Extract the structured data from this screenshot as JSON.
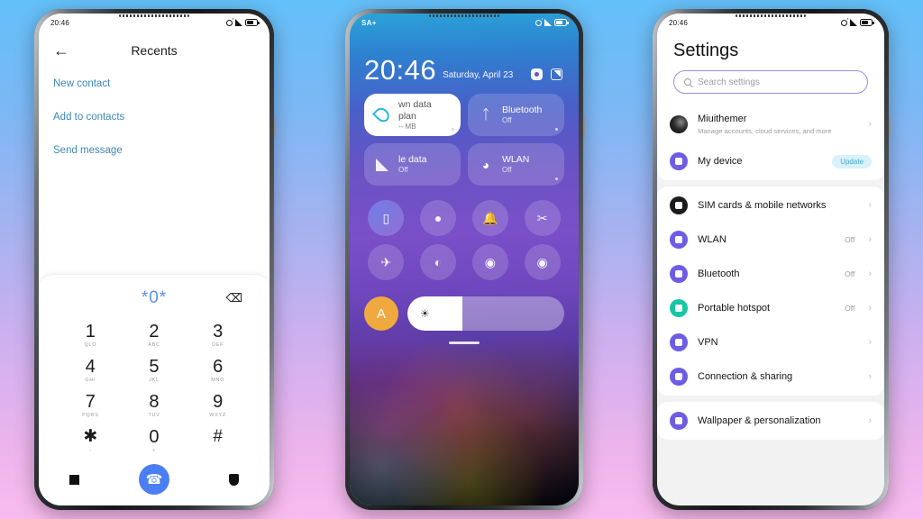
{
  "background": {
    "top_color": "#63c0f8",
    "bottom_color": "#f9bbee"
  },
  "phone1": {
    "status": {
      "time": "20:46"
    },
    "appbar": {
      "back_icon": "arrow-left-icon",
      "title": "Recents"
    },
    "links": [
      "New contact",
      "Add to contacts",
      "Send message"
    ],
    "dialer": {
      "number": "*0*",
      "delete_icon": "backspace-icon",
      "keys": [
        {
          "digit": "1",
          "letters": "QLD"
        },
        {
          "digit": "2",
          "letters": "ABC"
        },
        {
          "digit": "3",
          "letters": "DEF"
        },
        {
          "digit": "4",
          "letters": "GHI"
        },
        {
          "digit": "5",
          "letters": "JKL"
        },
        {
          "digit": "6",
          "letters": "MNO"
        },
        {
          "digit": "7",
          "letters": "PQRS"
        },
        {
          "digit": "8",
          "letters": "TUV"
        },
        {
          "digit": "9",
          "letters": "WXYZ"
        },
        {
          "digit": "✱",
          "letters": ","
        },
        {
          "digit": "0",
          "letters": "+"
        },
        {
          "digit": "#",
          "letters": ""
        }
      ],
      "left_icon": "keypad-hide-icon",
      "call_icon": "phone-call-icon",
      "right_icon": "shield-icon",
      "accent_color": "#4c7ef3",
      "number_color": "#5b8ff0"
    }
  },
  "phone2": {
    "status": {
      "carrier": "SA+"
    },
    "clock": {
      "time": "20:46",
      "date": "Saturday, April 23"
    },
    "header_icons": [
      "settings-gear-icon",
      "edit-tiles-icon"
    ],
    "tiles": [
      {
        "title": "wn data plan",
        "subtitle": "-- MB",
        "icon": "water-drop-icon",
        "style": "white"
      },
      {
        "title": "Bluetooth",
        "subtitle": "Off",
        "icon": "bluetooth-icon",
        "style": "translucent"
      },
      {
        "title": "le data",
        "subtitle": "Off",
        "icon": "mobile-signal-icon",
        "style": "translucent"
      },
      {
        "title": "WLAN",
        "subtitle": "Off",
        "icon": "wifi-icon",
        "style": "translucent"
      }
    ],
    "toggles": [
      {
        "name": "vibrate-icon",
        "glyph": "▯",
        "active": true
      },
      {
        "name": "flashlight-icon",
        "glyph": "●",
        "active": false
      },
      {
        "name": "ringer-bell-icon",
        "glyph": "🔔",
        "active": false
      },
      {
        "name": "screenshot-scissors-icon",
        "glyph": "✂",
        "active": false
      },
      {
        "name": "airplane-mode-icon",
        "glyph": "✈",
        "active": false
      },
      {
        "name": "dark-mode-icon",
        "glyph": "◐",
        "active": false
      },
      {
        "name": "location-icon",
        "glyph": "◉",
        "active": false
      },
      {
        "name": "screen-record-icon",
        "glyph": "◉",
        "active": false
      }
    ],
    "brightness": {
      "auto_label": "A",
      "auto_color": "#f0a93f",
      "level_percent": 35,
      "icon": "brightness-sun-icon"
    },
    "home_indicator": "home-bar"
  },
  "phone3": {
    "status": {
      "time": "20:46"
    },
    "title": "Settings",
    "search": {
      "placeholder": "Search settings",
      "icon": "search-icon",
      "border_color": "#9f8de6"
    },
    "account": {
      "name": "Miuithemer",
      "subtitle": "Manage accounts, cloud services, and more",
      "icon": "account-avatar"
    },
    "device": {
      "label": "My device",
      "badge": "Update",
      "icon_color": "#6c5ce7",
      "badge_bg": "#d8f1fb",
      "badge_color": "#4ba7c9"
    },
    "network_group": [
      {
        "label": "SIM cards & mobile networks",
        "value": "",
        "icon_color": "#1b1b1b"
      },
      {
        "label": "WLAN",
        "value": "Off",
        "icon_color": "#6c5ce7"
      },
      {
        "label": "Bluetooth",
        "value": "Off",
        "icon_color": "#6c5ce7"
      },
      {
        "label": "Portable hotspot",
        "value": "Off",
        "icon_color": "#17c6a3"
      },
      {
        "label": "VPN",
        "value": "",
        "icon_color": "#6c5ce7"
      },
      {
        "label": "Connection & sharing",
        "value": "",
        "icon_color": "#6c5ce7"
      }
    ],
    "personal_group": [
      {
        "label": "Wallpaper & personalization",
        "value": "",
        "icon_color": "#6c5ce7"
      }
    ]
  }
}
